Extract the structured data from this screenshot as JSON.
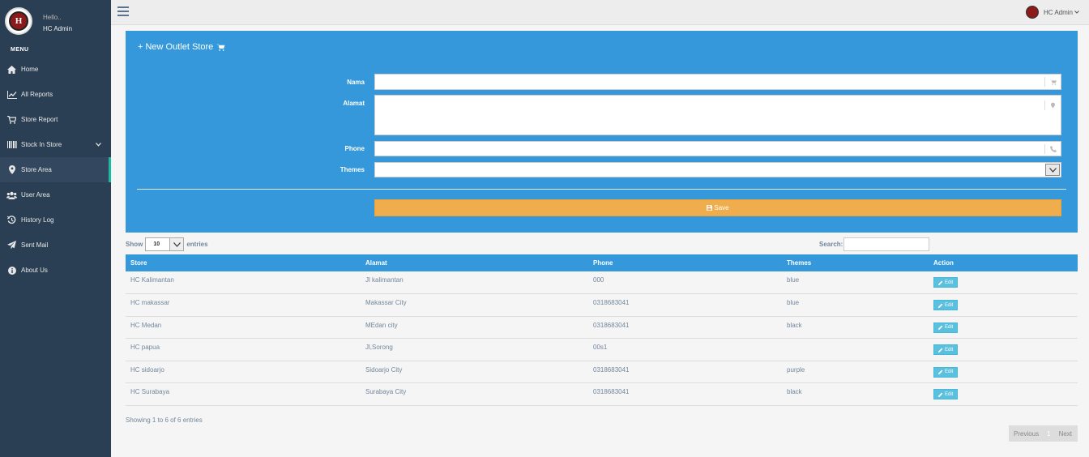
{
  "sidebar": {
    "greeting": "Hello..",
    "username": "HC Admin",
    "menu_title": "MENU",
    "items": [
      {
        "label": "Home",
        "icon": "home-icon"
      },
      {
        "label": "All Reports",
        "icon": "line-chart-icon"
      },
      {
        "label": "Store Report",
        "icon": "cart-icon"
      },
      {
        "label": "Stock In Store",
        "icon": "barcode-icon"
      },
      {
        "label": "Store Area",
        "icon": "map-marker-icon"
      },
      {
        "label": "User Area",
        "icon": "users-icon"
      },
      {
        "label": "History Log",
        "icon": "history-icon"
      },
      {
        "label": "Sent Mail",
        "icon": "paper-plane-icon"
      },
      {
        "label": "About Us",
        "icon": "info-icon"
      }
    ],
    "active_item": "Store Area"
  },
  "topbar": {
    "user_label": "HC Admin"
  },
  "form": {
    "title": "+ New Outlet Store",
    "nama_label": "Nama",
    "alamat_label": "Alamat",
    "phone_label": "Phone",
    "themes_label": "Themes",
    "nama_value": "",
    "alamat_value": "",
    "phone_value": "",
    "themes_value": "",
    "save_label": "Save"
  },
  "table_controls": {
    "show_label": "Show",
    "entries_value": "10",
    "entries_label": "entries",
    "search_label": "Search:"
  },
  "table": {
    "headers": [
      "Store",
      "Alamat",
      "Phone",
      "Themes",
      "Action"
    ],
    "edit_label": "Edit",
    "rows": [
      {
        "store": "HC Kalimantan",
        "alamat": "Jl kalimantan",
        "phone": "000",
        "themes": "blue"
      },
      {
        "store": "HC makassar",
        "alamat": "Makassar City",
        "phone": "0318683041",
        "themes": "blue"
      },
      {
        "store": "HC Medan",
        "alamat": "MEdan city",
        "phone": "0318683041",
        "themes": "black"
      },
      {
        "store": "HC papua",
        "alamat": "Jl,Sorong",
        "phone": "00s1",
        "themes": ""
      },
      {
        "store": "HC sidoarjo",
        "alamat": "Sidoarjo City",
        "phone": "0318683041",
        "themes": "purple"
      },
      {
        "store": "HC Surabaya",
        "alamat": "Surabaya City",
        "phone": "0318683041",
        "themes": "black"
      }
    ]
  },
  "pagination": {
    "info": "Showing 1 to 6 of 6 entries",
    "previous": "Previous",
    "current_page": "1",
    "next": "Next"
  },
  "colors": {
    "sidebar": "#2a3f54",
    "panel": "#3498db",
    "save": "#f0ad4e",
    "edit": "#5bc0de",
    "active_indicator": "#1abb9c"
  }
}
